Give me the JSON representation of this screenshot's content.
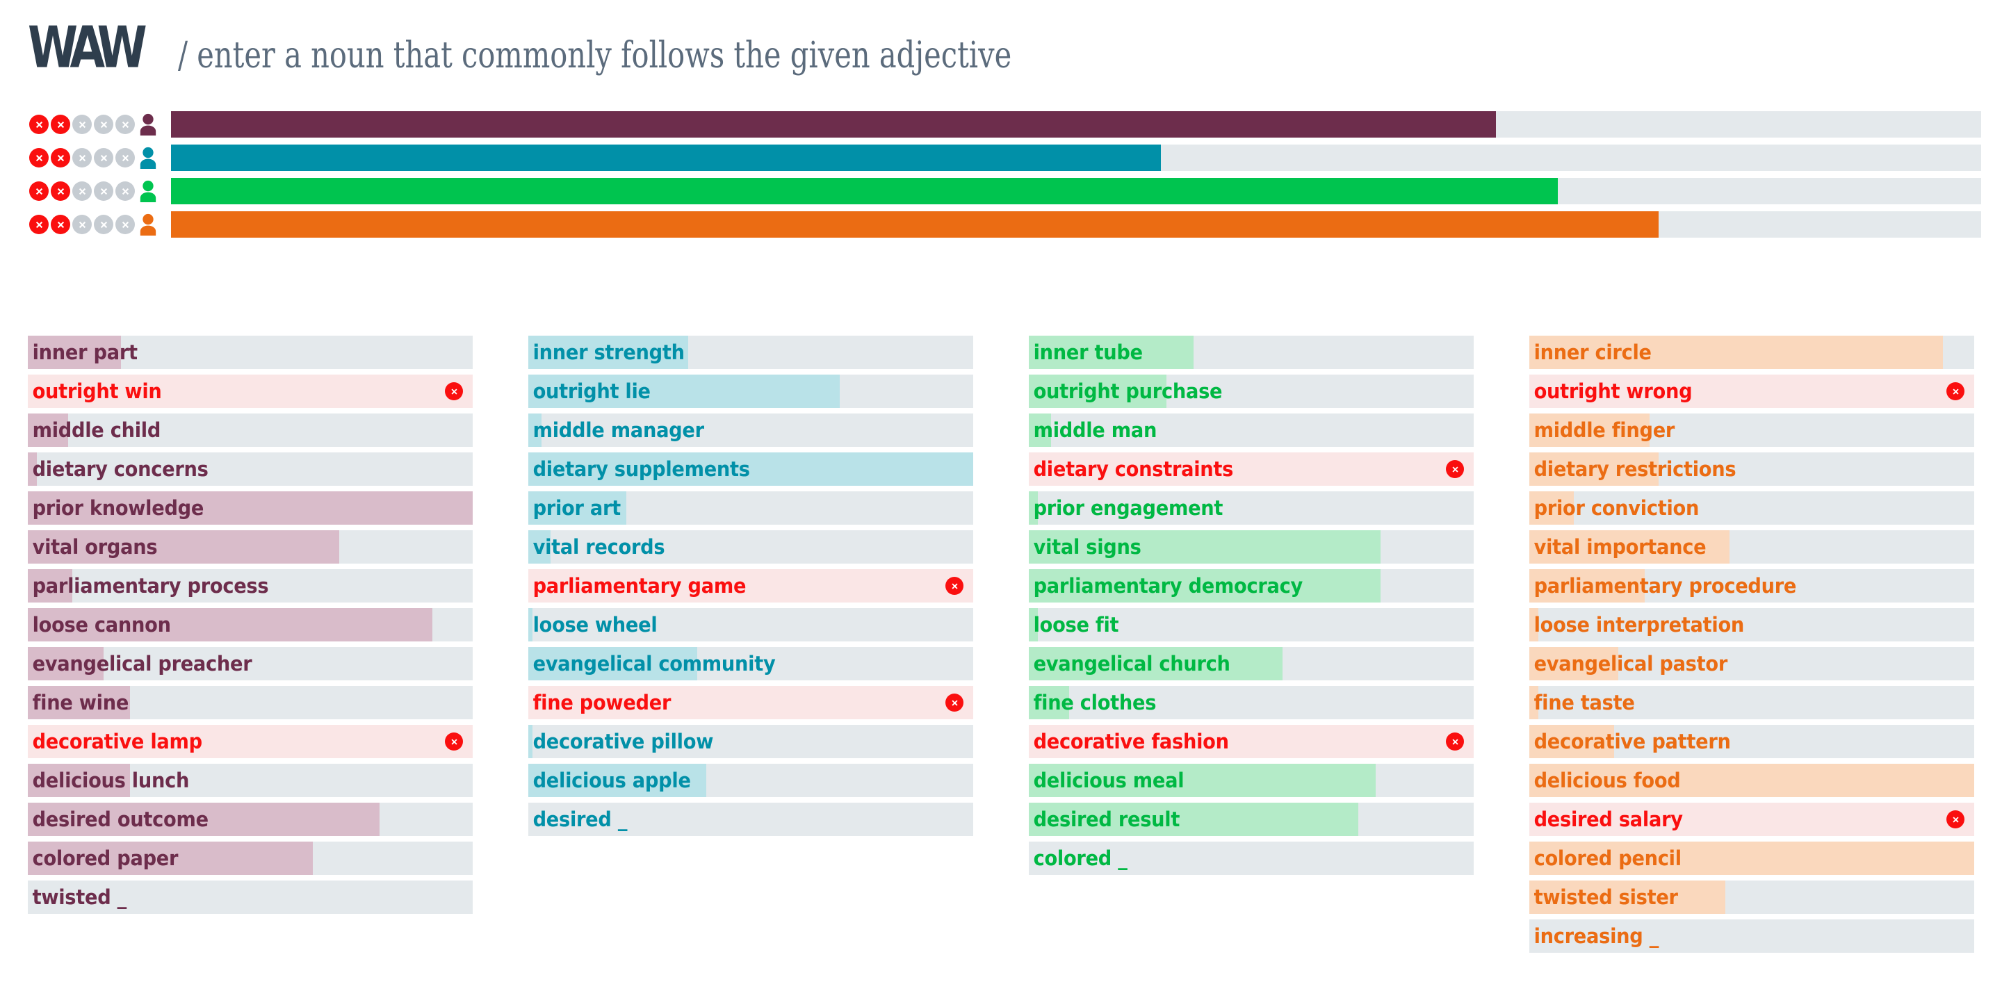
{
  "header": {
    "logo": "WAW",
    "separator": "/",
    "subtitle": "enter a noun that commonly follows the given adjective"
  },
  "corner_stripes": [
    "#722f4b",
    "#0692ab",
    "#00c44f",
    "#ec6a12"
  ],
  "lives_icon": "circle-x-icon",
  "avatar_icon": "user-icon",
  "players": [
    {
      "name": "player-1",
      "color": "#6d2d4c",
      "lives_lost": 2,
      "lives_total": 5,
      "score_pct": 73.2
    },
    {
      "name": "player-2",
      "color": "#0190a8",
      "lives_lost": 2,
      "lives_total": 5,
      "score_pct": 54.7
    },
    {
      "name": "player-3",
      "color": "#00c44f",
      "lives_lost": 2,
      "lives_total": 5,
      "score_pct": 76.6
    },
    {
      "name": "player-4",
      "color": "#eb6c13",
      "lives_lost": 2,
      "lives_total": 5,
      "score_pct": 82.2
    }
  ],
  "colors": {
    "row_track": "#e4e9ec",
    "row_wrong_bg": "#fae6e6",
    "wrong_text": "#fa0f0f",
    "life_lost": "#fa0f0f",
    "life_alive": "#c6ccd2",
    "logo": "#2f3e4d",
    "subtitle": "#5b6b7c"
  },
  "columns": [
    {
      "name": "column-player-1",
      "text_color": "#6d2d4c",
      "fill_color": "#d9bcca",
      "rows": [
        {
          "label": "inner part",
          "fill_pct": 21,
          "wrong": false,
          "x_icon": false
        },
        {
          "label": "outright win",
          "fill_pct": 100,
          "wrong": true,
          "x_icon": true
        },
        {
          "label": "middle child",
          "fill_pct": 9,
          "wrong": false,
          "x_icon": false
        },
        {
          "label": "dietary concerns",
          "fill_pct": 2,
          "wrong": false,
          "x_icon": false
        },
        {
          "label": "prior knowledge",
          "fill_pct": 100,
          "wrong": false,
          "x_icon": false
        },
        {
          "label": "vital organs",
          "fill_pct": 70,
          "wrong": false,
          "x_icon": false
        },
        {
          "label": "parliamentary process",
          "fill_pct": 10,
          "wrong": false,
          "x_icon": false
        },
        {
          "label": "loose cannon",
          "fill_pct": 91,
          "wrong": false,
          "x_icon": false
        },
        {
          "label": "evangelical preacher",
          "fill_pct": 17,
          "wrong": false,
          "x_icon": false
        },
        {
          "label": "fine wine",
          "fill_pct": 23,
          "wrong": false,
          "x_icon": false
        },
        {
          "label": "decorative lamp",
          "fill_pct": 100,
          "wrong": true,
          "x_icon": true
        },
        {
          "label": "delicious lunch",
          "fill_pct": 23,
          "wrong": false,
          "x_icon": false
        },
        {
          "label": "desired outcome",
          "fill_pct": 79,
          "wrong": false,
          "x_icon": false
        },
        {
          "label": "colored paper",
          "fill_pct": 64,
          "wrong": false,
          "x_icon": false
        },
        {
          "label": "twisted _",
          "fill_pct": 0,
          "wrong": false,
          "x_icon": false
        }
      ]
    },
    {
      "name": "column-player-2",
      "text_color": "#0190a8",
      "fill_color": "#b9e2e8",
      "rows": [
        {
          "label": "inner strength",
          "fill_pct": 36,
          "wrong": false,
          "x_icon": false
        },
        {
          "label": "outright lie",
          "fill_pct": 70,
          "wrong": false,
          "x_icon": false
        },
        {
          "label": "middle manager",
          "fill_pct": 3,
          "wrong": false,
          "x_icon": false
        },
        {
          "label": "dietary supplements",
          "fill_pct": 100,
          "wrong": false,
          "x_icon": false
        },
        {
          "label": "prior art",
          "fill_pct": 22,
          "wrong": false,
          "x_icon": false
        },
        {
          "label": "vital records",
          "fill_pct": 5,
          "wrong": false,
          "x_icon": false
        },
        {
          "label": "parliamentary game",
          "fill_pct": 100,
          "wrong": true,
          "x_icon": true
        },
        {
          "label": "loose wheel",
          "fill_pct": 1,
          "wrong": false,
          "x_icon": false
        },
        {
          "label": "evangelical community",
          "fill_pct": 38,
          "wrong": false,
          "x_icon": false
        },
        {
          "label": "fine poweder",
          "fill_pct": 100,
          "wrong": true,
          "x_icon": true
        },
        {
          "label": "decorative pillow",
          "fill_pct": 1,
          "wrong": false,
          "x_icon": false
        },
        {
          "label": "delicious apple",
          "fill_pct": 40,
          "wrong": false,
          "x_icon": false
        },
        {
          "label": "desired _",
          "fill_pct": 0,
          "wrong": false,
          "x_icon": false
        }
      ]
    },
    {
      "name": "column-player-3",
      "text_color": "#00b843",
      "fill_color": "#b4ebc8",
      "rows": [
        {
          "label": "inner tube",
          "fill_pct": 37,
          "wrong": false,
          "x_icon": false
        },
        {
          "label": "outright purchase",
          "fill_pct": 31,
          "wrong": false,
          "x_icon": false
        },
        {
          "label": "middle man",
          "fill_pct": 5,
          "wrong": false,
          "x_icon": false
        },
        {
          "label": "dietary constraints",
          "fill_pct": 100,
          "wrong": true,
          "x_icon": true
        },
        {
          "label": "prior engagement",
          "fill_pct": 2,
          "wrong": false,
          "x_icon": false
        },
        {
          "label": "vital signs",
          "fill_pct": 79,
          "wrong": false,
          "x_icon": false
        },
        {
          "label": "parliamentary democracy",
          "fill_pct": 79,
          "wrong": false,
          "x_icon": false
        },
        {
          "label": "loose fit",
          "fill_pct": 2,
          "wrong": false,
          "x_icon": false
        },
        {
          "label": "evangelical church",
          "fill_pct": 57,
          "wrong": false,
          "x_icon": false
        },
        {
          "label": "fine clothes",
          "fill_pct": 9,
          "wrong": false,
          "x_icon": false
        },
        {
          "label": "decorative fashion",
          "fill_pct": 100,
          "wrong": true,
          "x_icon": true
        },
        {
          "label": "delicious meal",
          "fill_pct": 78,
          "wrong": false,
          "x_icon": false
        },
        {
          "label": "desired result",
          "fill_pct": 74,
          "wrong": false,
          "x_icon": false
        },
        {
          "label": "colored _",
          "fill_pct": 0,
          "wrong": false,
          "x_icon": false
        }
      ]
    },
    {
      "name": "column-player-4",
      "text_color": "#eb6c13",
      "fill_color": "#fad8bd",
      "rows": [
        {
          "label": "inner circle",
          "fill_pct": 93,
          "wrong": false,
          "x_icon": false
        },
        {
          "label": "outright wrong",
          "fill_pct": 100,
          "wrong": true,
          "x_icon": true
        },
        {
          "label": "middle finger",
          "fill_pct": 27,
          "wrong": false,
          "x_icon": false
        },
        {
          "label": "dietary restrictions",
          "fill_pct": 29,
          "wrong": false,
          "x_icon": false
        },
        {
          "label": "prior conviction",
          "fill_pct": 10,
          "wrong": false,
          "x_icon": false
        },
        {
          "label": "vital importance",
          "fill_pct": 45,
          "wrong": false,
          "x_icon": false
        },
        {
          "label": "parliamentary procedure",
          "fill_pct": 26,
          "wrong": false,
          "x_icon": false
        },
        {
          "label": "loose interpretation",
          "fill_pct": 2,
          "wrong": false,
          "x_icon": false
        },
        {
          "label": "evangelical pastor",
          "fill_pct": 20,
          "wrong": false,
          "x_icon": false
        },
        {
          "label": "fine taste",
          "fill_pct": 2,
          "wrong": false,
          "x_icon": false
        },
        {
          "label": "decorative pattern",
          "fill_pct": 19,
          "wrong": false,
          "x_icon": false
        },
        {
          "label": "delicious food",
          "fill_pct": 100,
          "wrong": false,
          "x_icon": false
        },
        {
          "label": "desired salary",
          "fill_pct": 100,
          "wrong": true,
          "x_icon": true
        },
        {
          "label": "colored pencil",
          "fill_pct": 100,
          "wrong": false,
          "x_icon": false
        },
        {
          "label": "twisted sister",
          "fill_pct": 44,
          "wrong": false,
          "x_icon": false
        },
        {
          "label": "increasing _",
          "fill_pct": 0,
          "wrong": false,
          "x_icon": false
        }
      ]
    }
  ]
}
